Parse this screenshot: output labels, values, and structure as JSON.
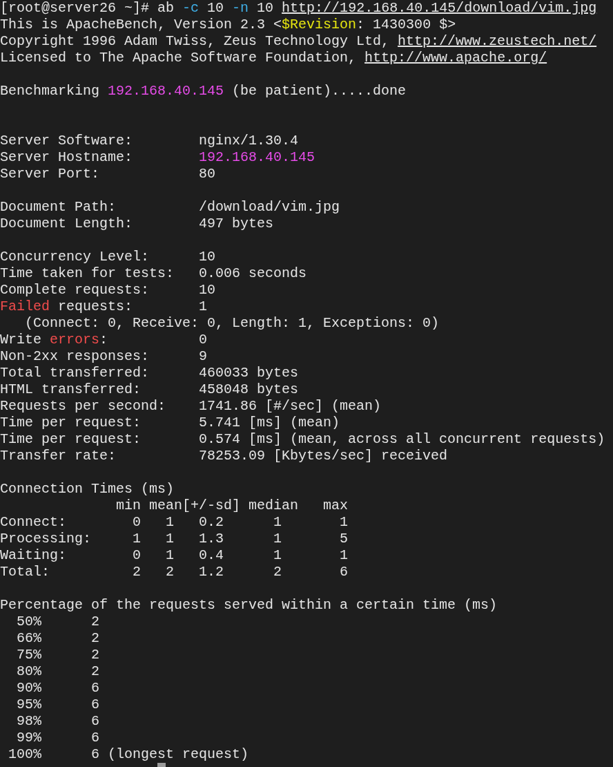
{
  "terminal": {
    "lines": [
      {
        "kind": "text",
        "spans": [
          {
            "text": "[root@server26 ~]# ab ",
            "kind": "plain"
          },
          {
            "text": "-c",
            "kind": "option"
          },
          {
            "text": " 10 ",
            "kind": "plain"
          },
          {
            "text": "-n",
            "kind": "option"
          },
          {
            "text": " 10 ",
            "kind": "plain"
          },
          {
            "text": "http://192.168.40.145/download/vim.jpg",
            "kind": "link"
          }
        ]
      },
      {
        "kind": "text",
        "spans": [
          {
            "text": "This is ApacheBench, Version 2.3 <",
            "kind": "plain"
          },
          {
            "text": "$Revision",
            "kind": "keyword"
          },
          {
            "text": ": 1430300 $>",
            "kind": "plain"
          }
        ]
      },
      {
        "kind": "text",
        "spans": [
          {
            "text": "Copyright 1996 Adam Twiss, Zeus Technology Ltd, ",
            "kind": "plain"
          },
          {
            "text": "http://www.zeustech.net/",
            "kind": "link"
          }
        ]
      },
      {
        "kind": "text",
        "spans": [
          {
            "text": "Licensed to The Apache Software Foundation, ",
            "kind": "plain"
          },
          {
            "text": "http://www.apache.org/",
            "kind": "link"
          }
        ]
      },
      {
        "kind": "blank"
      },
      {
        "kind": "text",
        "spans": [
          {
            "text": "Benchmarking ",
            "kind": "plain"
          },
          {
            "text": "192.168.40.145",
            "kind": "host"
          },
          {
            "text": " (be patient).....done",
            "kind": "plain"
          }
        ]
      },
      {
        "kind": "blank"
      },
      {
        "kind": "blank"
      },
      {
        "kind": "text",
        "spans": [
          {
            "text": "Server Software:        nginx/1.30.4",
            "kind": "plain"
          }
        ]
      },
      {
        "kind": "text",
        "spans": [
          {
            "text": "Server Hostname:        ",
            "kind": "plain"
          },
          {
            "text": "192.168.40.145",
            "kind": "host"
          }
        ]
      },
      {
        "kind": "text",
        "spans": [
          {
            "text": "Server Port:            80",
            "kind": "plain"
          }
        ]
      },
      {
        "kind": "blank"
      },
      {
        "kind": "text",
        "spans": [
          {
            "text": "Document Path:          /download/vim.jpg",
            "kind": "plain"
          }
        ]
      },
      {
        "kind": "text",
        "spans": [
          {
            "text": "Document Length:        497 bytes",
            "kind": "plain"
          }
        ]
      },
      {
        "kind": "blank"
      },
      {
        "kind": "text",
        "spans": [
          {
            "text": "Concurrency Level:      10",
            "kind": "plain"
          }
        ]
      },
      {
        "kind": "text",
        "spans": [
          {
            "text": "Time taken for tests:   0.006 seconds",
            "kind": "plain"
          }
        ]
      },
      {
        "kind": "text",
        "spans": [
          {
            "text": "Complete requests:      10",
            "kind": "plain"
          }
        ]
      },
      {
        "kind": "text",
        "spans": [
          {
            "text": "Failed",
            "kind": "error"
          },
          {
            "text": " requests:        1",
            "kind": "plain"
          }
        ]
      },
      {
        "kind": "text",
        "spans": [
          {
            "text": "   (Connect: 0, Receive: 0, Length: 1, Exceptions: 0)",
            "kind": "plain"
          }
        ]
      },
      {
        "kind": "text",
        "spans": [
          {
            "text": "Write ",
            "kind": "plain"
          },
          {
            "text": "errors",
            "kind": "error"
          },
          {
            "text": ":           0",
            "kind": "plain"
          }
        ]
      },
      {
        "kind": "text",
        "spans": [
          {
            "text": "Non-2xx responses:      9",
            "kind": "plain"
          }
        ]
      },
      {
        "kind": "text",
        "spans": [
          {
            "text": "Total transferred:      460033 bytes",
            "kind": "plain"
          }
        ]
      },
      {
        "kind": "text",
        "spans": [
          {
            "text": "HTML transferred:       458048 bytes",
            "kind": "plain"
          }
        ]
      },
      {
        "kind": "text",
        "spans": [
          {
            "text": "Requests per second:    1741.86 [#/sec] (mean)",
            "kind": "plain"
          }
        ]
      },
      {
        "kind": "text",
        "spans": [
          {
            "text": "Time per request:       5.741 [ms] (mean)",
            "kind": "plain"
          }
        ]
      },
      {
        "kind": "text",
        "spans": [
          {
            "text": "Time per request:       0.574 [ms] (mean, across all concurrent requests)",
            "kind": "plain"
          }
        ]
      },
      {
        "kind": "text",
        "spans": [
          {
            "text": "Transfer rate:          78253.09 [Kbytes/sec] received",
            "kind": "plain"
          }
        ]
      },
      {
        "kind": "blank"
      },
      {
        "kind": "text",
        "spans": [
          {
            "text": "Connection Times (ms)",
            "kind": "plain"
          }
        ]
      },
      {
        "kind": "text",
        "spans": [
          {
            "text": "              min mean[+/-sd] median   max",
            "kind": "plain"
          }
        ]
      },
      {
        "kind": "text",
        "spans": [
          {
            "text": "Connect:        0   1   0.2      1       1",
            "kind": "plain"
          }
        ]
      },
      {
        "kind": "text",
        "spans": [
          {
            "text": "Processing:     1   1   1.3      1       5",
            "kind": "plain"
          }
        ]
      },
      {
        "kind": "text",
        "spans": [
          {
            "text": "Waiting:        0   1   0.4      1       1",
            "kind": "plain"
          }
        ]
      },
      {
        "kind": "text",
        "spans": [
          {
            "text": "Total:          2   2   1.2      2       6",
            "kind": "plain"
          }
        ]
      },
      {
        "kind": "blank"
      },
      {
        "kind": "text",
        "spans": [
          {
            "text": "Percentage of the requests served within a certain time (ms)",
            "kind": "plain"
          }
        ]
      },
      {
        "kind": "text",
        "spans": [
          {
            "text": "  50%      2",
            "kind": "plain"
          }
        ]
      },
      {
        "kind": "text",
        "spans": [
          {
            "text": "  66%      2",
            "kind": "plain"
          }
        ]
      },
      {
        "kind": "text",
        "spans": [
          {
            "text": "  75%      2",
            "kind": "plain"
          }
        ]
      },
      {
        "kind": "text",
        "spans": [
          {
            "text": "  80%      2",
            "kind": "plain"
          }
        ]
      },
      {
        "kind": "text",
        "spans": [
          {
            "text": "  90%      6",
            "kind": "plain"
          }
        ]
      },
      {
        "kind": "text",
        "spans": [
          {
            "text": "  95%      6",
            "kind": "plain"
          }
        ]
      },
      {
        "kind": "text",
        "spans": [
          {
            "text": "  98%      6",
            "kind": "plain"
          }
        ]
      },
      {
        "kind": "text",
        "spans": [
          {
            "text": "  99%      6",
            "kind": "plain"
          }
        ]
      },
      {
        "kind": "text",
        "spans": [
          {
            "text": " 100%      6 (longest request)",
            "kind": "plain"
          }
        ]
      }
    ],
    "cursor": {
      "visible": true
    }
  }
}
